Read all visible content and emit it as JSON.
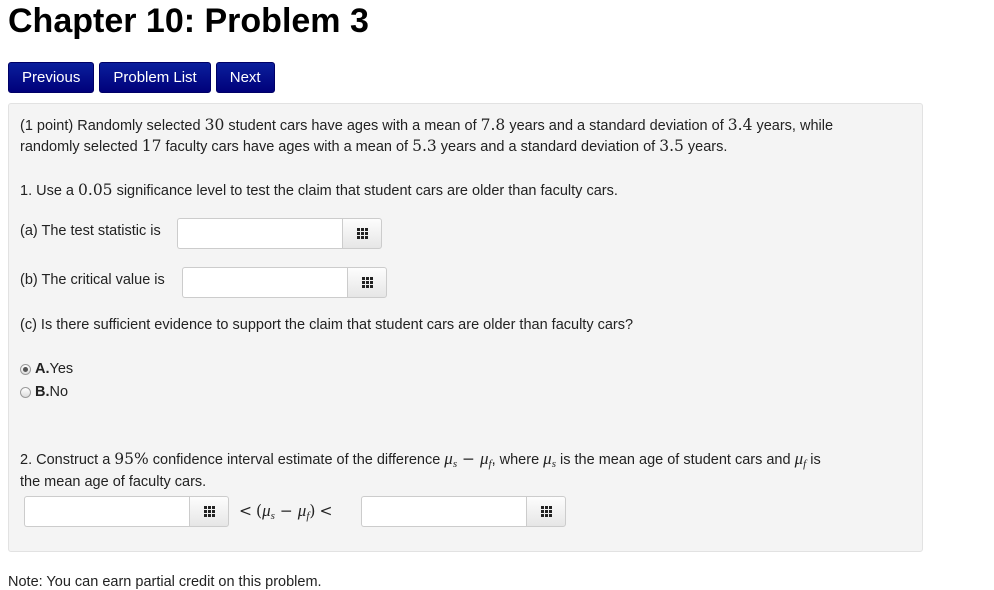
{
  "page_title": "Chapter 10: Problem 3",
  "nav": {
    "previous": "Previous",
    "problem_list": "Problem List",
    "next": "Next"
  },
  "problem": {
    "intro": {
      "points": "(1 point) Randomly selected ",
      "n1": "30",
      "t1": " student cars have ages with a mean of ",
      "mean1": "7.8",
      "t2": " years and a standard deviation of ",
      "sd1": "3.4",
      "t3": " years, while",
      "t4": "randomly selected ",
      "n2": "17",
      "t5": " faculty cars have ages with a mean of ",
      "mean2": "5.3",
      "t6": " years and a standard deviation of ",
      "sd2": "3.5",
      "t7": " years."
    },
    "part1": {
      "t1": "1. Use a ",
      "alpha": "0.05",
      "t2": " significance level to test the claim that student cars are older than faculty cars.",
      "a_label": "(a) The test statistic is",
      "a_value": "",
      "b_label": "(b) The critical value is",
      "b_value": "",
      "c_question": "(c) Is there sufficient evidence to support the claim that student cars are older than faculty cars?",
      "options": [
        {
          "letter": "A.",
          "text": " Yes",
          "selected": true
        },
        {
          "letter": "B.",
          "text": " No",
          "selected": false
        }
      ]
    },
    "part2": {
      "t1": "2. Construct a ",
      "conf": "95%",
      "t2": " confidence interval estimate of the difference ",
      "mu": "μ",
      "s": "s",
      "f": "f",
      "minus": " − ",
      "t3": ", where ",
      "t4": " is the mean age of student cars and ",
      "t5": " is",
      "line2": "the mean age of faculty cars.",
      "lower_value": "",
      "upper_value": "",
      "lt": "<"
    }
  },
  "footer_cut": "Note: You can earn partial credit on this problem."
}
